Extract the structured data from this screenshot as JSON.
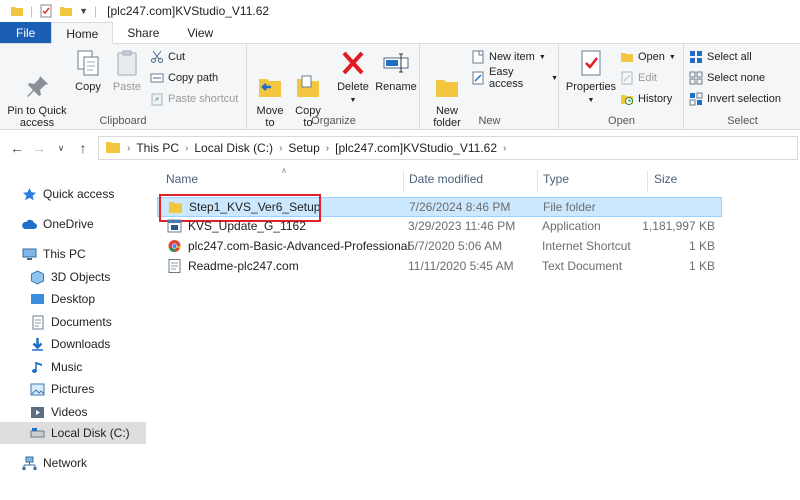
{
  "window": {
    "title": "[plc247.com]KVStudio_V11.62",
    "quick_access_dropdown": "▼"
  },
  "ribbon_tabs": [
    "File",
    "Home",
    "Share",
    "View"
  ],
  "ribbon": {
    "clipboard": {
      "label": "Clipboard",
      "pin_to_quick_access": "Pin to Quick\naccess",
      "copy": "Copy",
      "paste": "Paste",
      "cut": "Cut",
      "copy_path": "Copy path",
      "paste_shortcut": "Paste shortcut"
    },
    "organize": {
      "label": "Organize",
      "move_to": "Move\nto",
      "copy_to": "Copy\nto",
      "delete": "Delete",
      "rename": "Rename"
    },
    "new": {
      "label": "New",
      "new_folder": "New\nfolder",
      "new_item": "New item",
      "easy_access": "Easy access"
    },
    "open": {
      "label": "Open",
      "properties": "Properties",
      "open": "Open",
      "edit": "Edit",
      "history": "History"
    },
    "select": {
      "label": "Select",
      "select_all": "Select all",
      "select_none": "Select none",
      "invert_selection": "Invert selection"
    }
  },
  "address": {
    "crumbs": [
      "This PC",
      "Local Disk (C:)",
      "Setup",
      "[plc247.com]KVStudio_V11.62"
    ]
  },
  "sidebar": {
    "items": [
      {
        "label": "Quick access",
        "icon": "star-icon"
      },
      {
        "label": "OneDrive",
        "icon": "cloud-icon"
      },
      {
        "label": "This PC",
        "icon": "computer-icon"
      },
      {
        "label": "3D Objects",
        "icon": "cube-icon"
      },
      {
        "label": "Desktop",
        "icon": "desktop-icon"
      },
      {
        "label": "Documents",
        "icon": "documents-icon"
      },
      {
        "label": "Downloads",
        "icon": "download-icon"
      },
      {
        "label": "Music",
        "icon": "music-icon"
      },
      {
        "label": "Pictures",
        "icon": "pictures-icon"
      },
      {
        "label": "Videos",
        "icon": "videos-icon"
      },
      {
        "label": "Local Disk (C:)",
        "icon": "drive-icon"
      },
      {
        "label": "Network",
        "icon": "network-icon"
      }
    ]
  },
  "files": {
    "columns": [
      "Name",
      "Date modified",
      "Type",
      "Size"
    ],
    "rows": [
      {
        "name": "Step1_KVS_Ver6_Setup",
        "date": "7/26/2024 8:46 PM",
        "type": "File folder",
        "size": "",
        "icon": "folder-icon"
      },
      {
        "name": "KVS_Update_G_1162",
        "date": "3/29/2023 11:46 PM",
        "type": "Application",
        "size": "1,181,997 KB",
        "icon": "application-icon"
      },
      {
        "name": "plc247.com-Basic-Advanced-Professional",
        "date": "5/7/2020 5:06 AM",
        "type": "Internet Shortcut",
        "size": "1 KB",
        "icon": "chrome-icon"
      },
      {
        "name": "Readme-plc247.com",
        "date": "11/11/2020 5:45 AM",
        "type": "Text Document",
        "size": "1 KB",
        "icon": "text-file-icon"
      }
    ]
  },
  "colors": {
    "file_tab": "#1a5fb4",
    "selection_fill": "#cce8ff",
    "selection_border": "#99d1ff",
    "highlight_box": "#e0202a",
    "folder": "#f3c640",
    "delete_red": "#e21b23"
  }
}
